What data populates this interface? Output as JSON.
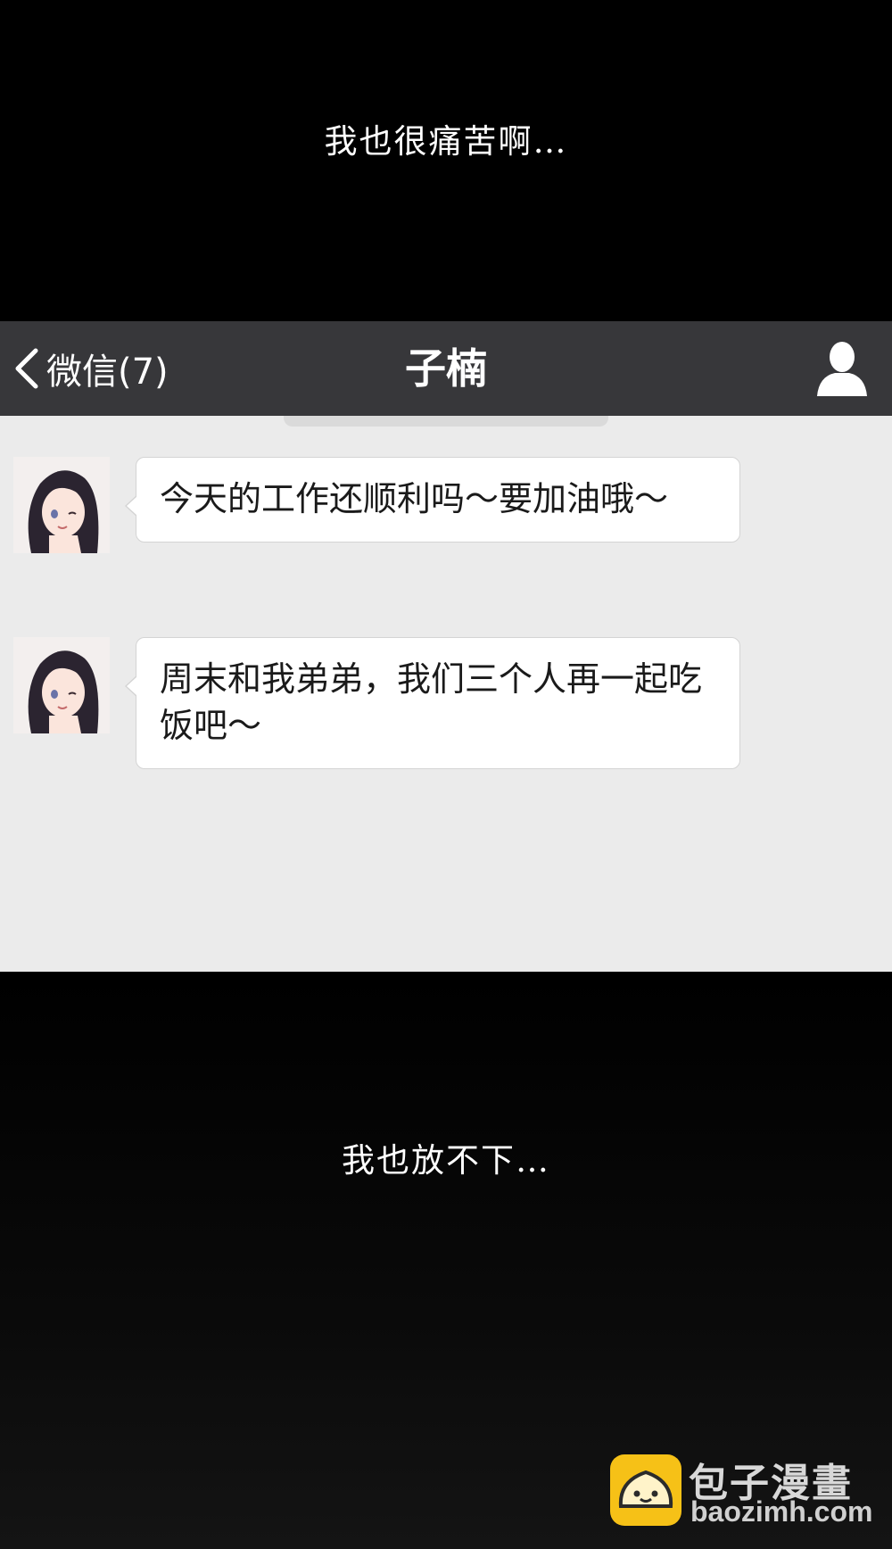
{
  "captions": {
    "top": "我也很痛苦啊…",
    "bottom": "我也放不下…"
  },
  "navbar": {
    "back_label": "微信(7)",
    "title": "子楠",
    "background": "#37373a"
  },
  "chat_background": "#ebebeb",
  "messages": [
    {
      "sender_avatar": "avatar-girl",
      "text": "今天的工作还顺利吗～要加油哦～"
    },
    {
      "sender_avatar": "avatar-girl",
      "text": "周末和我弟弟，我们三个人再一起吃饭吧～"
    }
  ],
  "watermark": {
    "name": "包子漫畫",
    "site": "baozimh.com",
    "logo_color": "#f6c117"
  }
}
